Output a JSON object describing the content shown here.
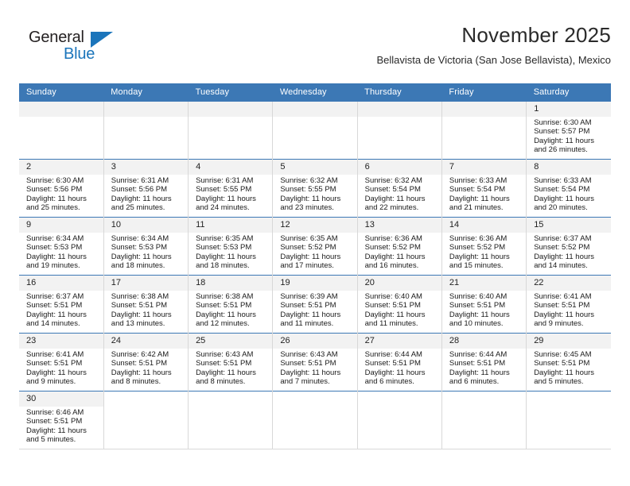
{
  "logo": {
    "word_one": "General",
    "word_two": "Blue",
    "icon": "triangle-mark"
  },
  "header": {
    "month_title": "November 2025",
    "location": "Bellavista de Victoria (San Jose Bellavista), Mexico"
  },
  "colors": {
    "header_blue": "#3c78b5",
    "logo_blue": "#1b75bb",
    "daynum_band": "#f2f2f2",
    "grid_line": "#d8d8d8"
  },
  "calendar": {
    "weekday_headers": [
      "Sunday",
      "Monday",
      "Tuesday",
      "Wednesday",
      "Thursday",
      "Friday",
      "Saturday"
    ],
    "labels": {
      "sunrise": "Sunrise:",
      "sunset": "Sunset:",
      "daylight": "Daylight:"
    },
    "weeks": [
      [
        {
          "empty": true
        },
        {
          "empty": true
        },
        {
          "empty": true
        },
        {
          "empty": true
        },
        {
          "empty": true
        },
        {
          "empty": true
        },
        {
          "day": "1",
          "sunrise": "Sunrise: 6:30 AM",
          "sunset": "Sunset: 5:57 PM",
          "daylight_1": "Daylight: 11 hours",
          "daylight_2": "and 26 minutes."
        }
      ],
      [
        {
          "day": "2",
          "sunrise": "Sunrise: 6:30 AM",
          "sunset": "Sunset: 5:56 PM",
          "daylight_1": "Daylight: 11 hours",
          "daylight_2": "and 25 minutes."
        },
        {
          "day": "3",
          "sunrise": "Sunrise: 6:31 AM",
          "sunset": "Sunset: 5:56 PM",
          "daylight_1": "Daylight: 11 hours",
          "daylight_2": "and 25 minutes."
        },
        {
          "day": "4",
          "sunrise": "Sunrise: 6:31 AM",
          "sunset": "Sunset: 5:55 PM",
          "daylight_1": "Daylight: 11 hours",
          "daylight_2": "and 24 minutes."
        },
        {
          "day": "5",
          "sunrise": "Sunrise: 6:32 AM",
          "sunset": "Sunset: 5:55 PM",
          "daylight_1": "Daylight: 11 hours",
          "daylight_2": "and 23 minutes."
        },
        {
          "day": "6",
          "sunrise": "Sunrise: 6:32 AM",
          "sunset": "Sunset: 5:54 PM",
          "daylight_1": "Daylight: 11 hours",
          "daylight_2": "and 22 minutes."
        },
        {
          "day": "7",
          "sunrise": "Sunrise: 6:33 AM",
          "sunset": "Sunset: 5:54 PM",
          "daylight_1": "Daylight: 11 hours",
          "daylight_2": "and 21 minutes."
        },
        {
          "day": "8",
          "sunrise": "Sunrise: 6:33 AM",
          "sunset": "Sunset: 5:54 PM",
          "daylight_1": "Daylight: 11 hours",
          "daylight_2": "and 20 minutes."
        }
      ],
      [
        {
          "day": "9",
          "sunrise": "Sunrise: 6:34 AM",
          "sunset": "Sunset: 5:53 PM",
          "daylight_1": "Daylight: 11 hours",
          "daylight_2": "and 19 minutes."
        },
        {
          "day": "10",
          "sunrise": "Sunrise: 6:34 AM",
          "sunset": "Sunset: 5:53 PM",
          "daylight_1": "Daylight: 11 hours",
          "daylight_2": "and 18 minutes."
        },
        {
          "day": "11",
          "sunrise": "Sunrise: 6:35 AM",
          "sunset": "Sunset: 5:53 PM",
          "daylight_1": "Daylight: 11 hours",
          "daylight_2": "and 18 minutes."
        },
        {
          "day": "12",
          "sunrise": "Sunrise: 6:35 AM",
          "sunset": "Sunset: 5:52 PM",
          "daylight_1": "Daylight: 11 hours",
          "daylight_2": "and 17 minutes."
        },
        {
          "day": "13",
          "sunrise": "Sunrise: 6:36 AM",
          "sunset": "Sunset: 5:52 PM",
          "daylight_1": "Daylight: 11 hours",
          "daylight_2": "and 16 minutes."
        },
        {
          "day": "14",
          "sunrise": "Sunrise: 6:36 AM",
          "sunset": "Sunset: 5:52 PM",
          "daylight_1": "Daylight: 11 hours",
          "daylight_2": "and 15 minutes."
        },
        {
          "day": "15",
          "sunrise": "Sunrise: 6:37 AM",
          "sunset": "Sunset: 5:52 PM",
          "daylight_1": "Daylight: 11 hours",
          "daylight_2": "and 14 minutes."
        }
      ],
      [
        {
          "day": "16",
          "sunrise": "Sunrise: 6:37 AM",
          "sunset": "Sunset: 5:51 PM",
          "daylight_1": "Daylight: 11 hours",
          "daylight_2": "and 14 minutes."
        },
        {
          "day": "17",
          "sunrise": "Sunrise: 6:38 AM",
          "sunset": "Sunset: 5:51 PM",
          "daylight_1": "Daylight: 11 hours",
          "daylight_2": "and 13 minutes."
        },
        {
          "day": "18",
          "sunrise": "Sunrise: 6:38 AM",
          "sunset": "Sunset: 5:51 PM",
          "daylight_1": "Daylight: 11 hours",
          "daylight_2": "and 12 minutes."
        },
        {
          "day": "19",
          "sunrise": "Sunrise: 6:39 AM",
          "sunset": "Sunset: 5:51 PM",
          "daylight_1": "Daylight: 11 hours",
          "daylight_2": "and 11 minutes."
        },
        {
          "day": "20",
          "sunrise": "Sunrise: 6:40 AM",
          "sunset": "Sunset: 5:51 PM",
          "daylight_1": "Daylight: 11 hours",
          "daylight_2": "and 11 minutes."
        },
        {
          "day": "21",
          "sunrise": "Sunrise: 6:40 AM",
          "sunset": "Sunset: 5:51 PM",
          "daylight_1": "Daylight: 11 hours",
          "daylight_2": "and 10 minutes."
        },
        {
          "day": "22",
          "sunrise": "Sunrise: 6:41 AM",
          "sunset": "Sunset: 5:51 PM",
          "daylight_1": "Daylight: 11 hours",
          "daylight_2": "and 9 minutes."
        }
      ],
      [
        {
          "day": "23",
          "sunrise": "Sunrise: 6:41 AM",
          "sunset": "Sunset: 5:51 PM",
          "daylight_1": "Daylight: 11 hours",
          "daylight_2": "and 9 minutes."
        },
        {
          "day": "24",
          "sunrise": "Sunrise: 6:42 AM",
          "sunset": "Sunset: 5:51 PM",
          "daylight_1": "Daylight: 11 hours",
          "daylight_2": "and 8 minutes."
        },
        {
          "day": "25",
          "sunrise": "Sunrise: 6:43 AM",
          "sunset": "Sunset: 5:51 PM",
          "daylight_1": "Daylight: 11 hours",
          "daylight_2": "and 8 minutes."
        },
        {
          "day": "26",
          "sunrise": "Sunrise: 6:43 AM",
          "sunset": "Sunset: 5:51 PM",
          "daylight_1": "Daylight: 11 hours",
          "daylight_2": "and 7 minutes."
        },
        {
          "day": "27",
          "sunrise": "Sunrise: 6:44 AM",
          "sunset": "Sunset: 5:51 PM",
          "daylight_1": "Daylight: 11 hours",
          "daylight_2": "and 6 minutes."
        },
        {
          "day": "28",
          "sunrise": "Sunrise: 6:44 AM",
          "sunset": "Sunset: 5:51 PM",
          "daylight_1": "Daylight: 11 hours",
          "daylight_2": "and 6 minutes."
        },
        {
          "day": "29",
          "sunrise": "Sunrise: 6:45 AM",
          "sunset": "Sunset: 5:51 PM",
          "daylight_1": "Daylight: 11 hours",
          "daylight_2": "and 5 minutes."
        }
      ],
      [
        {
          "day": "30",
          "sunrise": "Sunrise: 6:46 AM",
          "sunset": "Sunset: 5:51 PM",
          "daylight_1": "Daylight: 11 hours",
          "daylight_2": "and 5 minutes."
        },
        {
          "blank": true
        },
        {
          "blank": true
        },
        {
          "blank": true
        },
        {
          "blank": true
        },
        {
          "blank": true
        },
        {
          "blank": true
        }
      ]
    ]
  }
}
